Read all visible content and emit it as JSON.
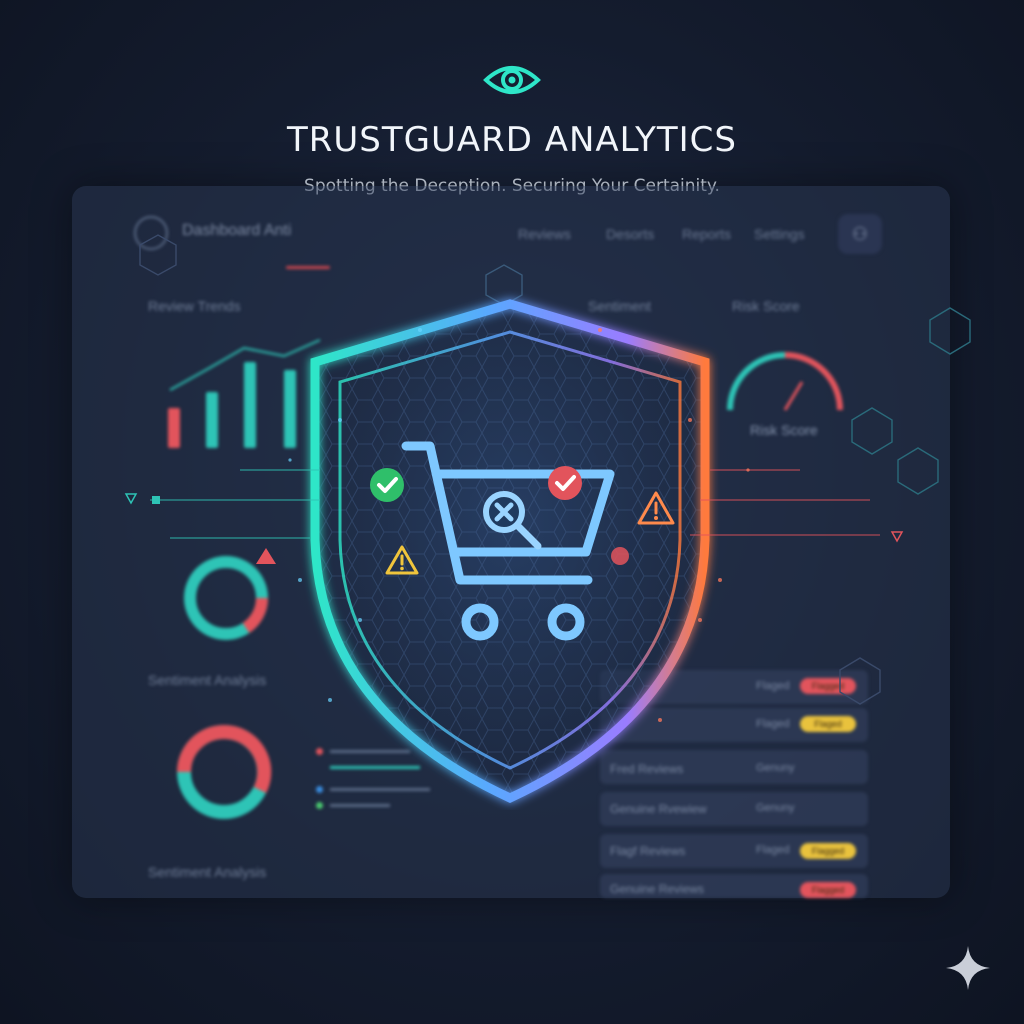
{
  "brand": {
    "title": "TRUSTGUARD ANALYTICS",
    "tagline": "Spotting the Deception. Securing Your Certainity."
  },
  "nav": {
    "title": "Dashboard Anti",
    "links": [
      "Reviews",
      "Desorts",
      "Reports",
      "Settings"
    ]
  },
  "sections": {
    "review_trends": "Review Trends",
    "risk_score_header": "Risk Score",
    "risk_score_caption": "Risk Score",
    "sentiment_analysis": "Sentiment Analysis",
    "sentiment_analysis_footer": "Sentiment Analysis"
  },
  "review_rows": [
    {
      "label": "",
      "status": "Flaged",
      "pill": "Flagged",
      "pill_color": "#e2545c"
    },
    {
      "label": "",
      "status": "Flaged",
      "pill": "Flaged",
      "pill_color": "#e9c23d"
    },
    {
      "label": "Fred Reviews",
      "status": "Genuny",
      "pill": "",
      "pill_color": ""
    },
    {
      "label": "Genuine Rvewiew",
      "status": "Genuny",
      "pill": "",
      "pill_color": ""
    },
    {
      "label": "Flagf Reviews",
      "status": "Flaged",
      "pill": "Flagged",
      "pill_color": "#e9c23d"
    },
    {
      "label": "Genuine Reviews",
      "status": "",
      "pill": "Flagged",
      "pill_color": "#e2545c"
    }
  ],
  "colors": {
    "accent_teal": "#2ec4b6",
    "accent_red": "#e2545c",
    "accent_orange": "#f08a3c",
    "accent_yellow": "#e9c23d",
    "shield_blue": "#5aa8ff"
  },
  "icons": {
    "brand": "eye-icon",
    "center": "shopping-cart-icon",
    "search": "magnifier-x-icon",
    "check": "checkmark-icon",
    "warning": "warning-icon",
    "corner": "sparkle-icon"
  }
}
